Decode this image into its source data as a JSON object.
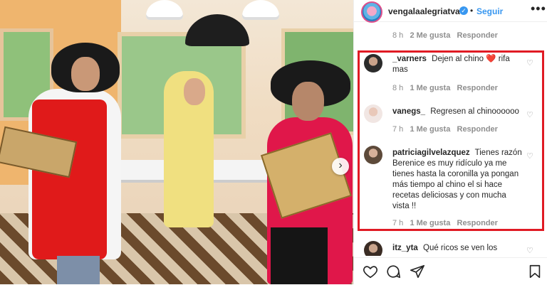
{
  "header": {
    "username": "vengalaalegriatva",
    "verified_mark": "✓",
    "separator": "•",
    "follow_label": "Seguir",
    "more_icon": "more-horizontal-icon",
    "more_glyph": "•••"
  },
  "top_meta": {
    "time": "8 h",
    "likes": "2 Me gusta",
    "reply": "Responder"
  },
  "comments": [
    {
      "username": "_varners",
      "text": "Dejen al chino",
      "emoji": "❤️",
      "text_after": "rifa mas",
      "time": "8 h",
      "likes": "1 Me gusta",
      "reply": "Responder"
    },
    {
      "username": "vanegs_",
      "text": "Regresen al chinoooooo",
      "time": "7 h",
      "likes": "1 Me gusta",
      "reply": "Responder"
    },
    {
      "username": "patriciagilvelazquez",
      "text": "Tienes razón Berenice es muy ridículo ya me tienes hasta la coronilla ya pongan más tiempo al chino el si hace recetas deliciosas y con mucha vista !!",
      "time": "7 h",
      "likes": "1 Me gusta",
      "reply": "Responder"
    },
    {
      "username": "itz_yta",
      "text": "Qué ricos se ven los"
    }
  ],
  "actions": {
    "like_icon": "heart-icon",
    "comment_icon": "comment-icon",
    "share_icon": "send-icon",
    "save_icon": "bookmark-icon"
  },
  "photo": {
    "next_icon": "chevron-right-icon",
    "next_glyph": "›"
  },
  "colors": {
    "highlight": "#e01b24",
    "link_blue": "#3897f0",
    "text": "#262626",
    "muted": "#8e8e8e"
  }
}
